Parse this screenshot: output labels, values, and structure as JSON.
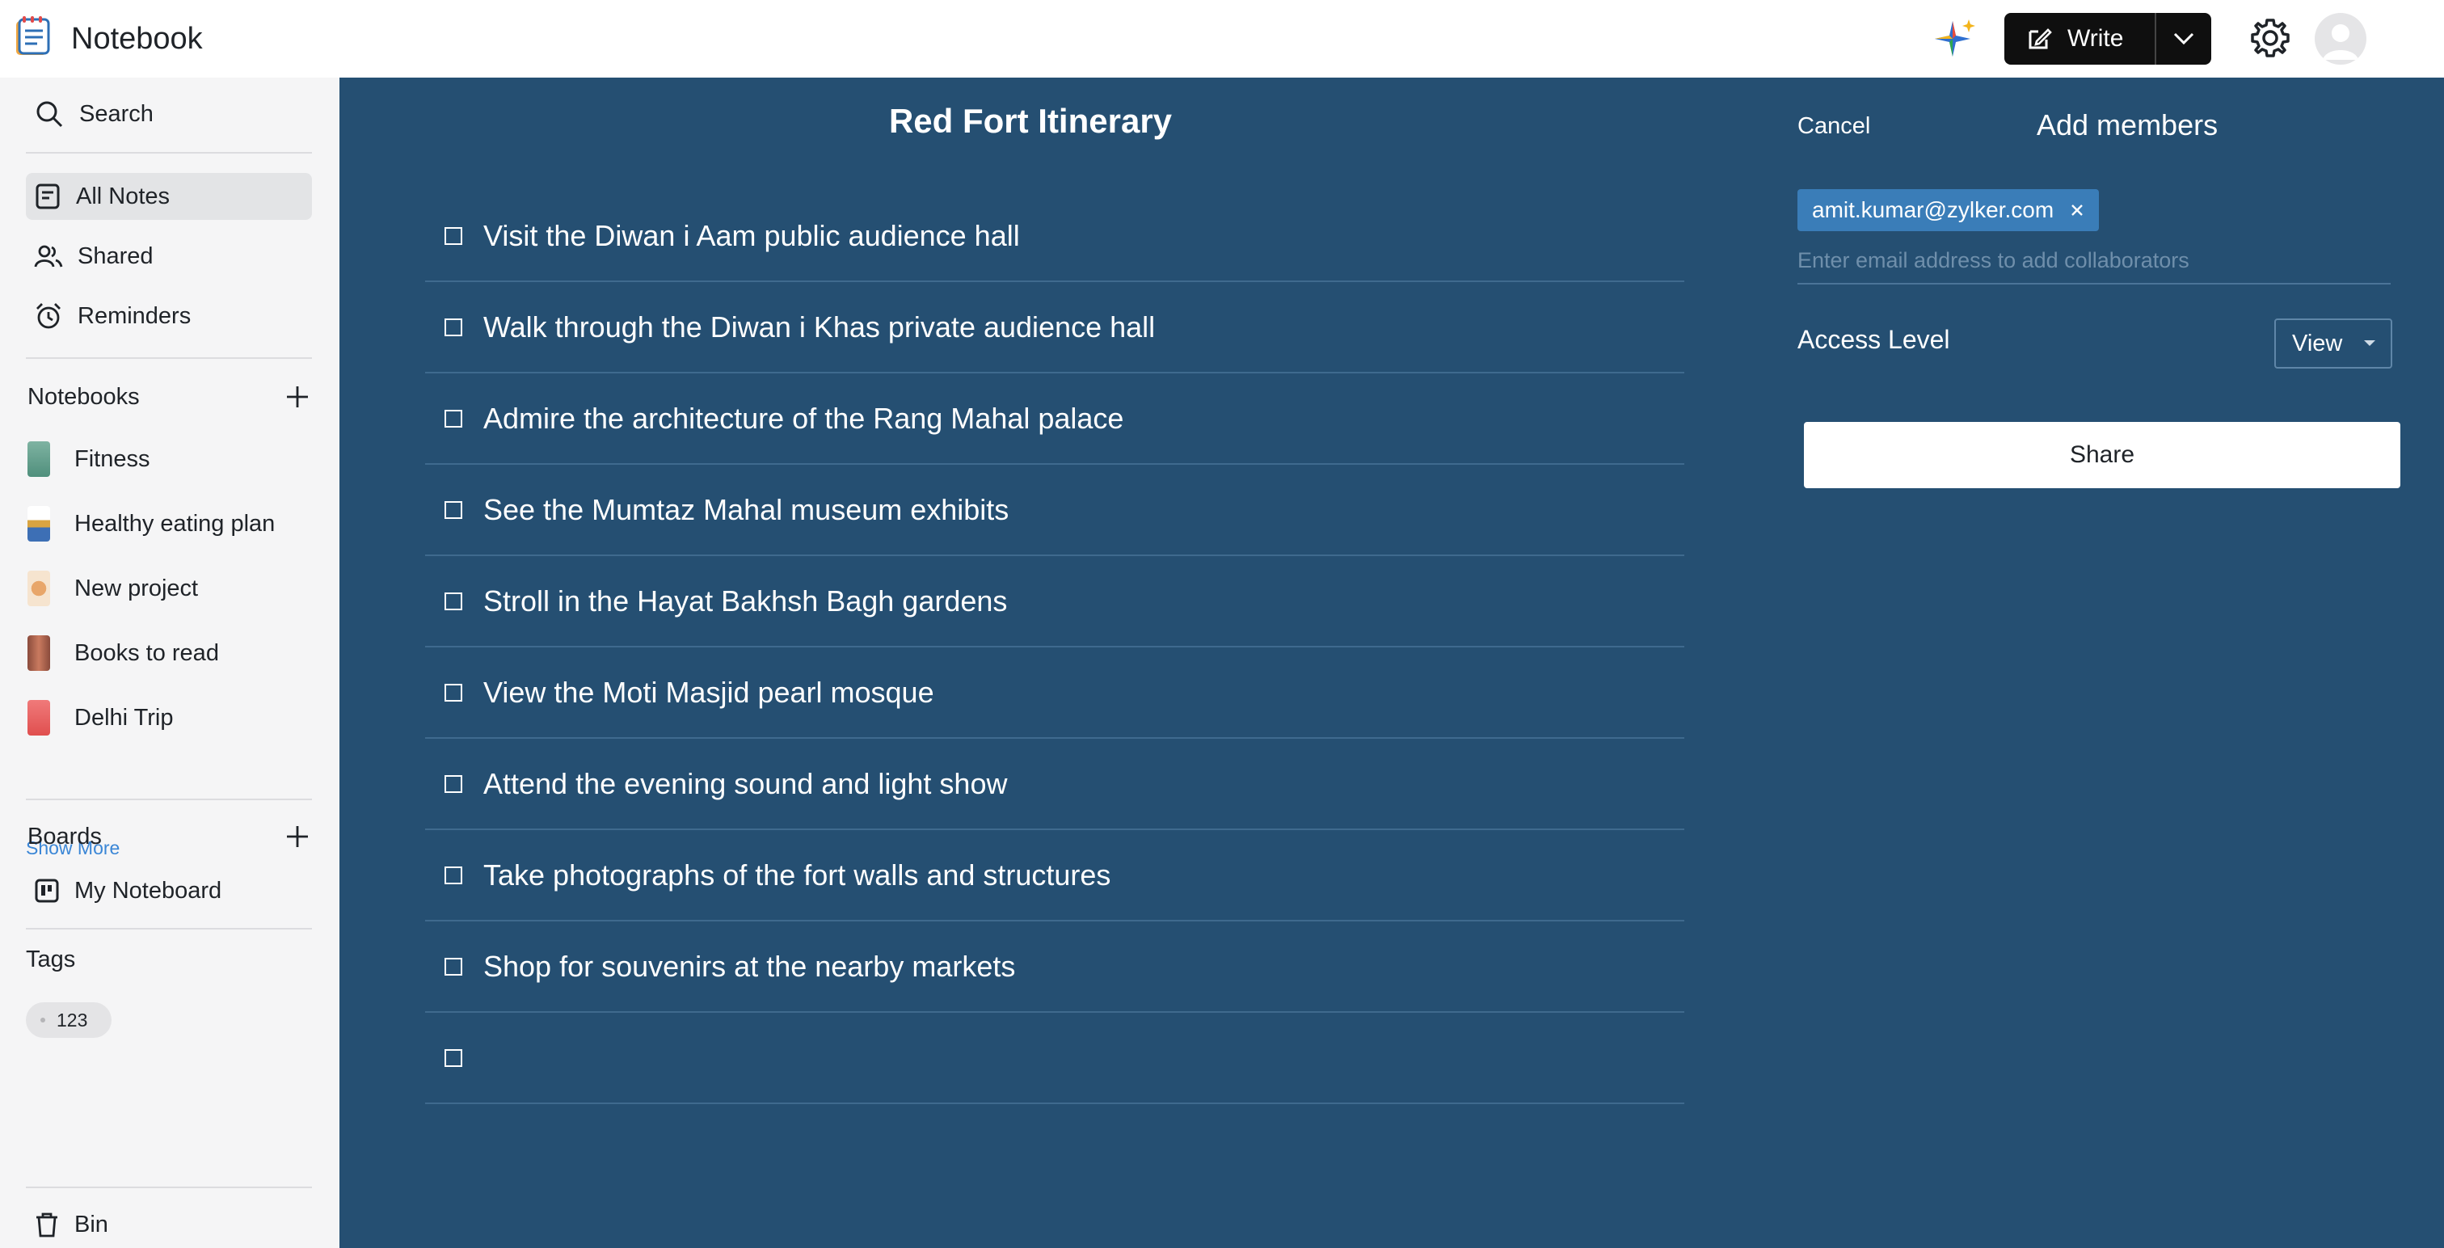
{
  "app": {
    "title": "Notebook"
  },
  "topbar": {
    "write_label": "Write"
  },
  "sidebar": {
    "search_label": "Search",
    "nav": [
      {
        "label": "All Notes",
        "active": true
      },
      {
        "label": "Shared"
      },
      {
        "label": "Reminders"
      }
    ],
    "notebooks_heading": "Notebooks",
    "notebooks": [
      {
        "label": "Fitness",
        "color": "#7fb3a2"
      },
      {
        "label": "Healthy eating plan",
        "color": "#d9a441"
      },
      {
        "label": "New project",
        "color": "#e8a66a"
      },
      {
        "label": "Books to read",
        "color": "#8a4b3c"
      },
      {
        "label": "Delhi Trip",
        "color": "#e36b6b"
      }
    ],
    "show_more": "Show More",
    "boards_heading": "Boards",
    "boards": [
      {
        "label": "My Noteboard"
      }
    ],
    "tags_heading": "Tags",
    "tags": [
      "123"
    ],
    "bin_label": "Bin"
  },
  "note": {
    "title": "Red Fort Itinerary",
    "tasks": [
      "Visit the Diwan i Aam public audience hall",
      "Walk through the Diwan i Khas private audience hall",
      "Admire the architecture of the Rang Mahal palace",
      "See the Mumtaz Mahal museum exhibits",
      "Stroll in the Hayat Bakhsh Bagh gardens",
      "View the Moti Masjid pearl mosque",
      "Attend the evening sound and light show",
      "Take photographs of the fort walls and structures",
      "Shop for souvenirs at the nearby markets",
      ""
    ]
  },
  "share_panel": {
    "cancel_label": "Cancel",
    "title": "Add members",
    "member_email": "amit.kumar@zylker.com",
    "email_placeholder": "Enter email address to add collaborators",
    "access_label": "Access Level",
    "access_value": "View",
    "share_label": "Share"
  },
  "colors": {
    "main_bg": "#254f72",
    "sidebar_bg": "#f5f5f6",
    "accent_link": "#3a86d6",
    "chip_bg": "#3a7db8"
  }
}
